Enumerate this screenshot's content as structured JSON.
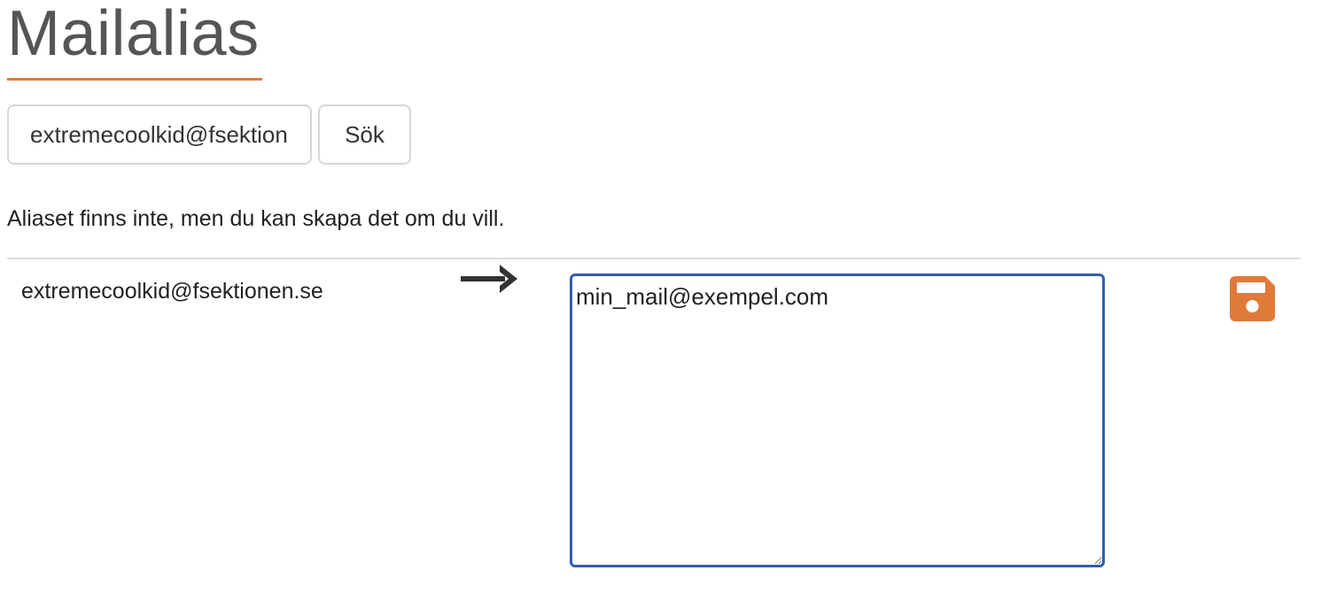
{
  "header": {
    "title": "Mailalias"
  },
  "search": {
    "value": "extremecoolkid@fsektionen.se",
    "button_label": "Sök"
  },
  "message": {
    "text": "Aliaset finns inte, men du kan skapa det om du vill."
  },
  "alias_row": {
    "alias": "extremecoolkid@fsektionen.se",
    "arrow_icon": "arrow-right-icon",
    "targets_value": "min_mail@exempel.com",
    "save_icon": "floppy-disk-icon"
  },
  "colors": {
    "accent": "#e07a3a",
    "focus_border": "#2f5fad",
    "title_text": "#555555"
  }
}
